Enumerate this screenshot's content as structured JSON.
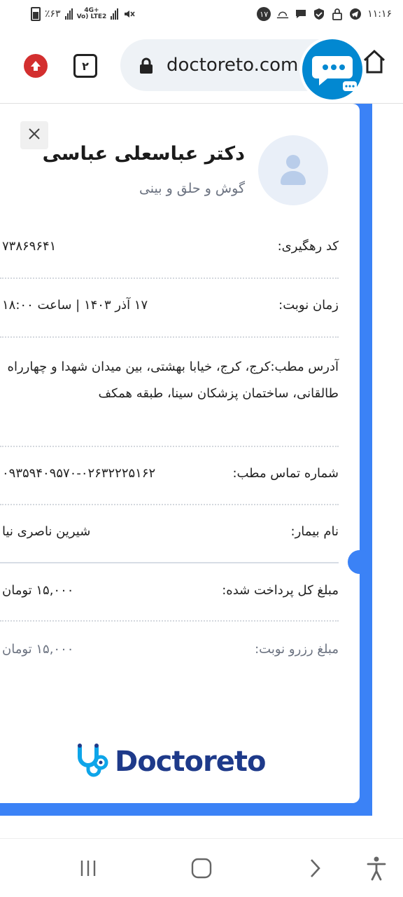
{
  "status_bar": {
    "battery_text": "٪۶۳",
    "network_line1": "4G+",
    "network_line2": "Vo) LTE2",
    "notification_count": "۱۷",
    "time": "۱۱:۱۶"
  },
  "browser": {
    "url": "doctoreto.com",
    "tab_count": "۲"
  },
  "doctor": {
    "name": "دکتر عباسعلی عباسی",
    "specialty": "گوش و حلق و بینی"
  },
  "appointment": {
    "tracking_label": "کد رهگیری:",
    "tracking_value": "۷۳۸۶۹۶۴۱",
    "time_label": "زمان نوبت:",
    "time_value": "۱۷ آذر ۱۴۰۳ | ساعت ۱۸:۰۰",
    "address_label": "آدرس مطب:",
    "address_value": "کرج، کرج، خیابا بهشتی، بین میدان شهدا و چهارراه طالقانی، ساختمان پزشکان سینا، طبقه همکف",
    "phone_label": "شماره تماس مطب:",
    "phone_value": "۰۹۳۵۹۴۰۹۵۷۰-۰۲۶۳۲۲۲۵۱۶۲",
    "patient_label": "نام بیمار:",
    "patient_value": "شیرین ناصری نیا",
    "total_paid_label": "مبلغ کل پرداخت شده:",
    "total_paid_value": "۱۵,۰۰۰ تومان",
    "reservation_label": "مبلغ رزرو نوبت:",
    "reservation_value": "۱۵,۰۰۰ تومان"
  },
  "brand": {
    "logo_text": "Doctoreto",
    "colors": {
      "primary": "#3b82f6",
      "logo": "#1e3a8a",
      "logo_icon": "#0ea5e9",
      "alert": "#d32f2f"
    }
  },
  "icons": [
    "battery-icon",
    "signal-icon",
    "mute-icon",
    "weather-icon",
    "message-icon",
    "shield-icon",
    "lock-icon",
    "telegram-icon",
    "upload-icon",
    "home-icon",
    "chat-icon",
    "close-icon",
    "user-icon",
    "recent-apps-icon",
    "home-nav-icon",
    "back-icon",
    "accessibility-icon"
  ]
}
